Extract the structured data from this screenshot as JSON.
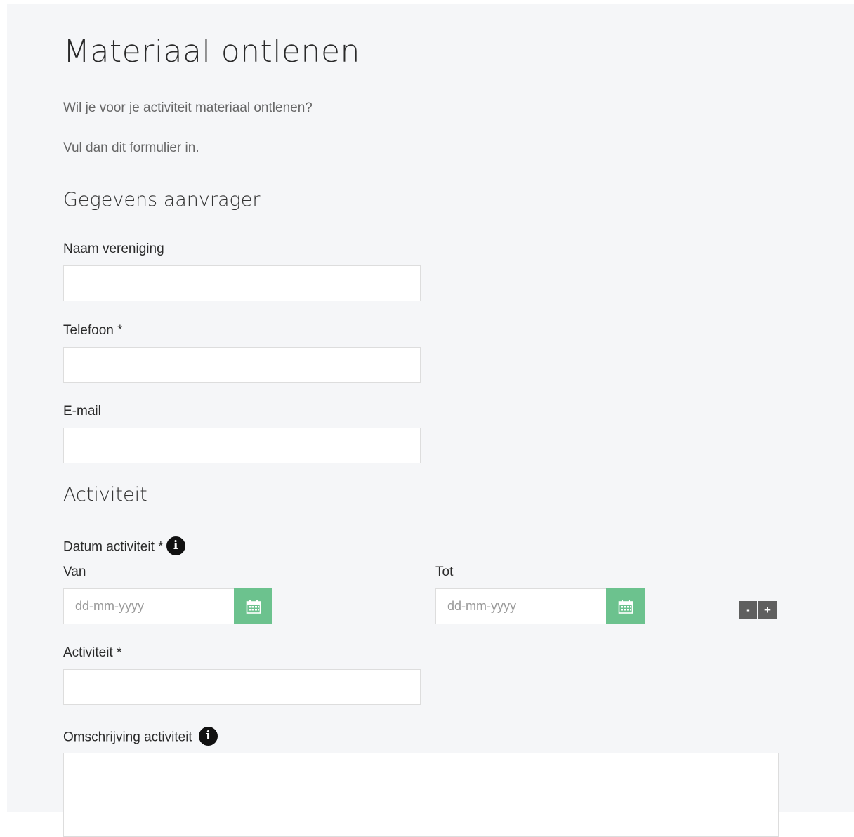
{
  "page": {
    "title": "Materiaal ontlenen",
    "intro_1": "Wil je voor je activiteit materiaal ontlenen?",
    "intro_2": "Vul dan dit formulier in."
  },
  "section_applicant": {
    "heading": "Gegevens aanvrager",
    "fields": {
      "naam_label": "Naam vereniging",
      "naam_value": "",
      "telefoon_label": "Telefoon *",
      "telefoon_value": "",
      "email_label": "E-mail",
      "email_value": ""
    }
  },
  "section_activity": {
    "heading": "Activiteit",
    "date_label": "Datum activiteit *",
    "from_label": "Van",
    "to_label": "Tot",
    "date_placeholder": "dd-mm-yyyy",
    "minus_label": "-",
    "plus_label": "+",
    "activity_label": "Activiteit *",
    "activity_value": "",
    "description_label": "Omschrijving activiteit",
    "description_value": ""
  },
  "icons": {
    "info": "info-icon",
    "calendar": "calendar-icon"
  },
  "colors": {
    "calendar_button": "#6cc28e",
    "stepper_button": "#5f5f5f",
    "panel_background": "#f5f6f8"
  }
}
